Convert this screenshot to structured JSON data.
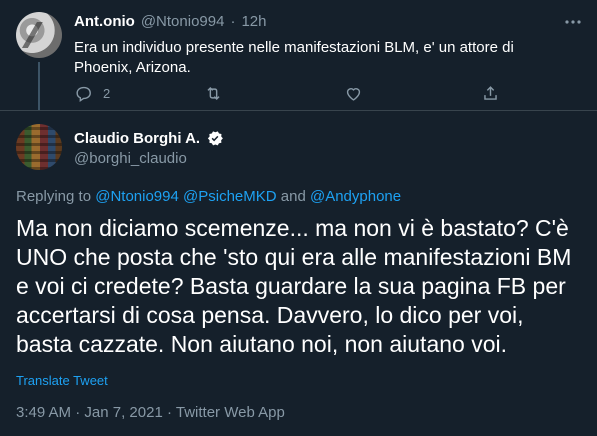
{
  "parent_tweet": {
    "name": "Ant.onio",
    "handle": "@Ntonio994",
    "separator": "·",
    "time": "12h",
    "text": "Era un individuo presente nelle manifestazioni BLM, e' un attore di Phoenix, Arizona.",
    "reply_count": "2",
    "icons": [
      "reply-icon",
      "retweet-icon",
      "like-icon",
      "share-icon",
      "caret-icon"
    ]
  },
  "main_tweet": {
    "name": "Claudio Borghi A.",
    "handle": "@borghi_claudio",
    "replying_label": "Replying to",
    "replying_to": [
      "@Ntonio994",
      "@PsicheMKD",
      "@Andyphone"
    ],
    "replying_and": "and",
    "text": "Ma non diciamo scemenze... ma non vi è bastato? C'è UNO che posta che 'sto qui era alle manifestazioni BM e voi ci credete? Basta guardare la sua pagina FB per accertarsi di cosa pensa. Davvero, lo dico per voi, basta cazzate. Non aiutano noi, non aiutano voi.",
    "translate_label": "Translate Tweet",
    "time": "3:49 AM",
    "date": "Jan 7, 2021",
    "source": "Twitter Web App",
    "separator": "·"
  },
  "colors": {
    "background": "#15202b",
    "muted": "#8899a6",
    "accent": "#1da1f2",
    "divider": "#38444d"
  }
}
